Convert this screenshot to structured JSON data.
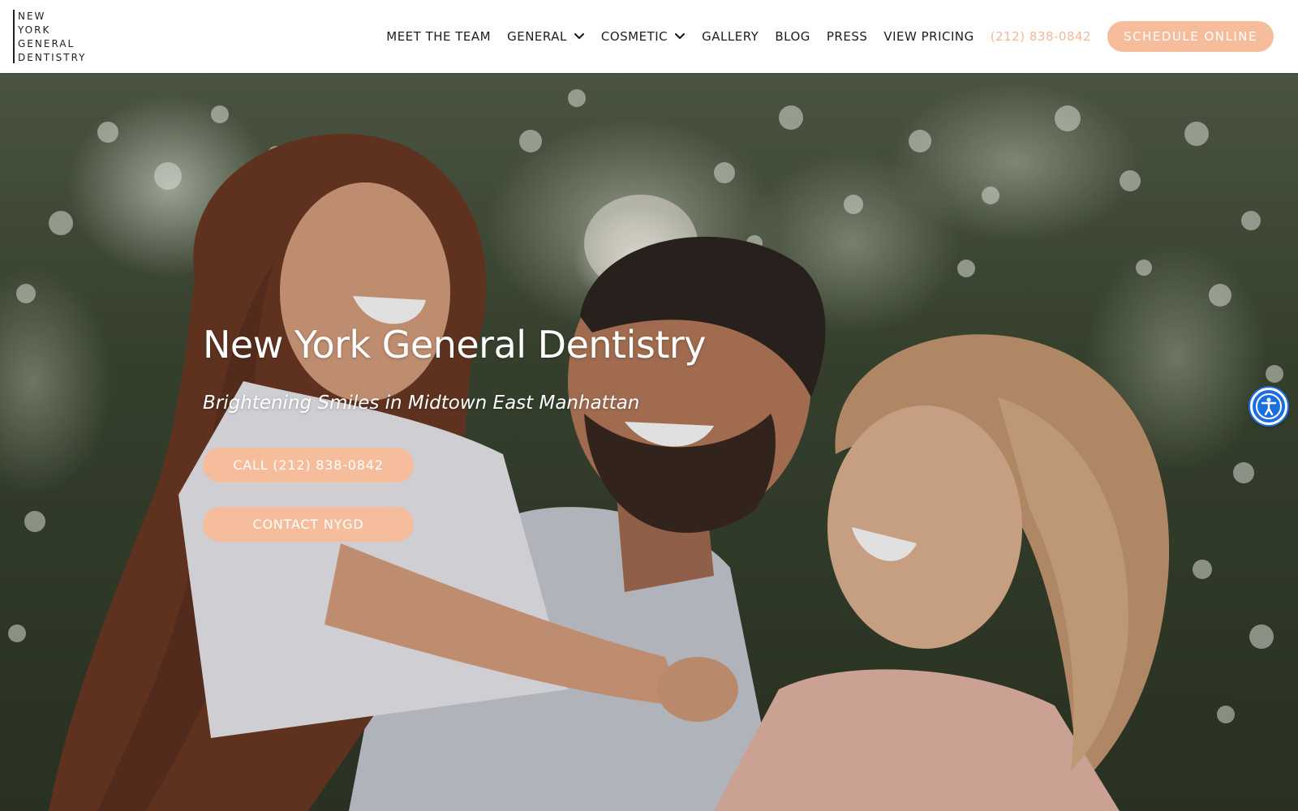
{
  "brand": {
    "logo_lines": [
      "NEW",
      "YORK",
      "GENERAL",
      "DENTISTRY"
    ]
  },
  "nav": {
    "items": [
      {
        "label": "MEET THE TEAM",
        "dropdown": false
      },
      {
        "label": "GENERAL",
        "dropdown": true
      },
      {
        "label": "COSMETIC",
        "dropdown": true
      },
      {
        "label": "GALLERY",
        "dropdown": false
      },
      {
        "label": "BLOG",
        "dropdown": false
      },
      {
        "label": "PRESS",
        "dropdown": false
      },
      {
        "label": "VIEW PRICING",
        "dropdown": false
      }
    ],
    "phone": "(212) 838-0842",
    "schedule_label": "SCHEDULE ONLINE"
  },
  "hero": {
    "title": "New York General Dentistry",
    "subtitle": "Brightening Smiles in Midtown East Manhattan",
    "call_button": "CALL (212) 838-0842",
    "contact_button": "CONTACT NYGD"
  },
  "icons": {
    "dropdown": "chevron-down-icon",
    "accessibility": "accessibility-icon"
  },
  "colors": {
    "accent": "#f6bd9c",
    "phone_text": "#f1b896",
    "nav_text": "#1d1d1d",
    "accessibility": "#1a6ee0"
  }
}
